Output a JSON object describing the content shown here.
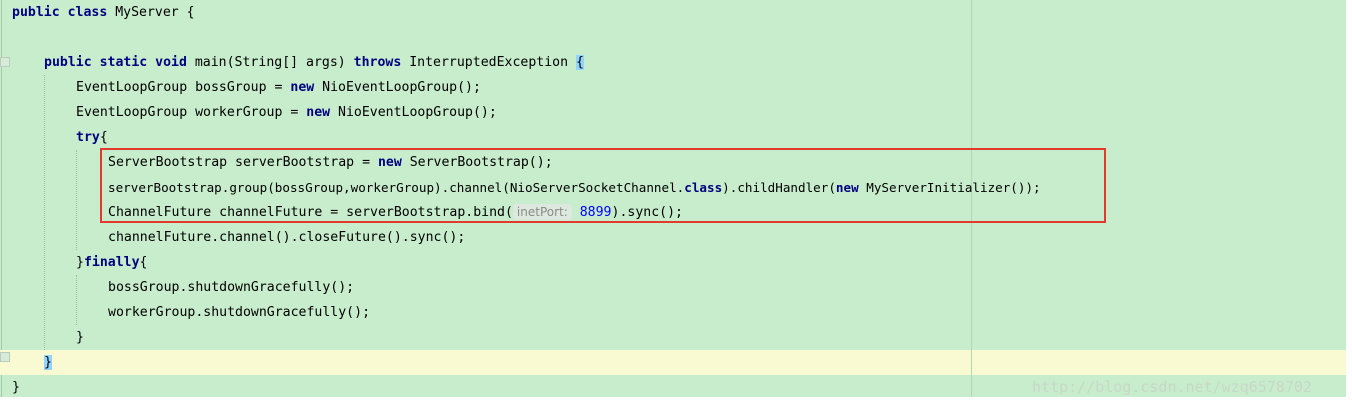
{
  "code": {
    "line1": {
      "kw": "public class ",
      "rest": "MyServer {"
    },
    "line3": {
      "kw": "public static void ",
      "mid": "main(String[] args) ",
      "kw2": "throws ",
      "rest": "InterruptedException ",
      "brace": "{"
    },
    "line4": {
      "pre": "EventLoopGroup bossGroup = ",
      "kw": "new ",
      "rest": "NioEventLoopGroup();"
    },
    "line5": {
      "pre": "EventLoopGroup workerGroup = ",
      "kw": "new ",
      "rest": "NioEventLoopGroup();"
    },
    "line6": {
      "kw": "try",
      "rest": "{"
    },
    "line7": {
      "pre": "ServerBootstrap serverBootstrap = ",
      "kw": "new ",
      "rest": "ServerBootstrap();"
    },
    "line8": {
      "pre": "serverBootstrap.group(bossGroup,workerGroup).channel(NioServerSocketChannel.",
      "kw": "class",
      "mid": ").childHandler(",
      "kw2": "new ",
      "rest": "MyServerInitializer());"
    },
    "line9": {
      "pre": "ChannelFuture channelFuture = serverBootstrap.bind(",
      "hint": "inetPort:",
      "num": "8899",
      "rest": ").sync();"
    },
    "line10": {
      "text": "channelFuture.channel().closeFuture().sync();"
    },
    "line11": {
      "pre": "}",
      "kw": "finally",
      "rest": "{"
    },
    "line12": {
      "text": "bossGroup.shutdownGracefully();"
    },
    "line13": {
      "text": "workerGroup.shutdownGracefully();"
    },
    "line14": {
      "text": "}"
    },
    "line15": {
      "brace": "}"
    },
    "line16": {
      "text": "}"
    }
  },
  "watermark": "http://blog.csdn.net/wzq6578702",
  "colors": {
    "editor_bg": "#c7edcc",
    "keyword": "#000080",
    "number": "#0000ff",
    "highlight_box": "#e23b2e",
    "caret_row": "#fafad2"
  }
}
